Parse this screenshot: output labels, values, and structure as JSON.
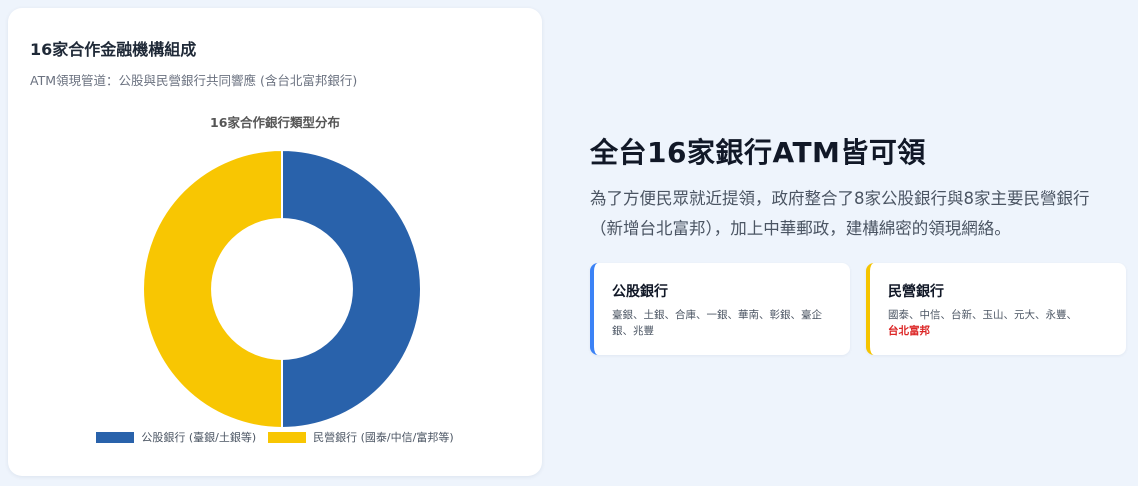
{
  "left_panel": {
    "title": "16家合作金融機構組成",
    "subtitle": "ATM領現管道：公股與民營銀行共同響應 (含台北富邦銀行)"
  },
  "chart_data": {
    "type": "pie",
    "title": "16家合作銀行類型分布",
    "categories": [
      "公股銀行 (臺銀/土銀等)",
      "民營銀行 (國泰/中信/富邦等)"
    ],
    "values": [
      8,
      8
    ],
    "colors": [
      "#2962ab",
      "#f8c602"
    ],
    "donut": true,
    "legend_position": "bottom"
  },
  "right_panel": {
    "headline": "全台16家銀行ATM皆可領",
    "intro": "為了方便民眾就近提領，政府整合了8家公股銀行與8家主要民營銀行（新增台北富邦），加上中華郵政，建構綿密的領現網絡。",
    "public_card": {
      "title": "公股銀行",
      "list": "臺銀、土銀、合庫、一銀、華南、彰銀、臺企銀、兆豐"
    },
    "private_card": {
      "title": "民營銀行",
      "list": "國泰、中信、台新、玉山、元大、永豐、",
      "highlight": "台北富邦"
    },
    "accent_colors": {
      "public": "#3b82f6",
      "private": "#f5c400",
      "highlight": "#dc2626"
    }
  }
}
